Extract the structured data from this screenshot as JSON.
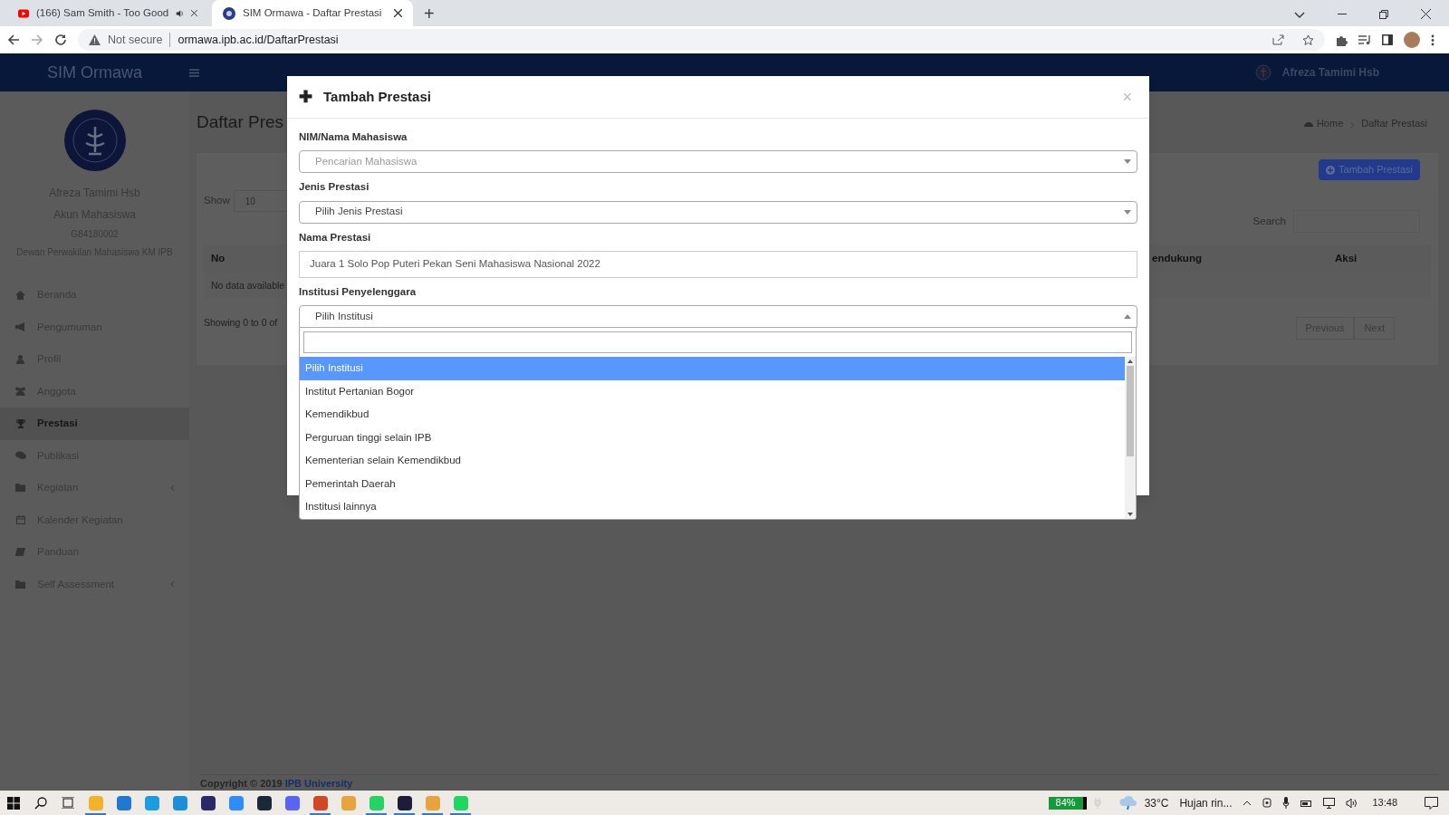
{
  "browser": {
    "tabs": [
      {
        "title": "(166) Sam Smith - Too Good",
        "selected": false,
        "audio": true
      },
      {
        "title": "SIM Ormawa - Daftar Prestasi",
        "selected": true,
        "audio": false
      }
    ],
    "new_tab": "+",
    "security": "Not secure",
    "url": "ormawa.ipb.ac.id/DaftarPrestasi"
  },
  "navbar": {
    "brand": "SIM Ormawa",
    "user": "Afreza Tamimi Hsb"
  },
  "sidebar": {
    "name": "Afreza Tamimi Hsb",
    "role": "Akun Mahasiswa",
    "nim": "G84180002",
    "organization": "Dewan Perwakilan Mahasiswa KM IPB",
    "items": [
      {
        "label": "Beranda",
        "selected": false,
        "expandable": false
      },
      {
        "label": "Pengumuman",
        "selected": false,
        "expandable": false
      },
      {
        "label": "Profil",
        "selected": false,
        "expandable": false
      },
      {
        "label": "Anggota",
        "selected": false,
        "expandable": false
      },
      {
        "label": "Prestasi",
        "selected": true,
        "expandable": false
      },
      {
        "label": "Publikasi",
        "selected": false,
        "expandable": false
      },
      {
        "label": "Kegiatan",
        "selected": false,
        "expandable": true
      },
      {
        "label": "Kalender Kegiatan",
        "selected": false,
        "expandable": false
      },
      {
        "label": "Panduan",
        "selected": false,
        "expandable": false
      },
      {
        "label": "Self Assessment",
        "selected": false,
        "expandable": true
      }
    ]
  },
  "content": {
    "title": "Daftar Pres",
    "breadcrumb": [
      "Home",
      "Daftar Prestasi"
    ],
    "add_button": "Tambah Prestasi",
    "show_label": "Show",
    "page_size": "10",
    "search_label": "Search",
    "table": {
      "columns": [
        "No",
        "endukung",
        "Aksi"
      ],
      "empty_text": "No data available"
    },
    "info": "Showing 0 to 0 of",
    "pagination": [
      "Previous",
      "Next"
    ]
  },
  "footer": {
    "text": "Copyright © 2019",
    "link": "IPB University"
  },
  "modal": {
    "icon": "✚",
    "title": "Tambah Prestasi",
    "close": "×",
    "fields": [
      {
        "label": "NIM/Nama Mahasiswa",
        "kind": "select",
        "placeholder": "Pencarian Mahasiswa",
        "open": false
      },
      {
        "label": "Jenis Prestasi",
        "kind": "select",
        "value": "Pilih Jenis Prestasi",
        "open": false
      },
      {
        "label": "Nama Prestasi",
        "kind": "text",
        "value": "Juara 1 Solo Pop Puteri Pekan Seni Mahasiswa Nasional 2022"
      },
      {
        "label": "Institusi Penyelenggara",
        "kind": "select",
        "value": "Pilih Institusi",
        "open": true,
        "options": [
          {
            "label": "Pilih Institusi",
            "selected": true
          },
          {
            "label": "Institut Pertanian Bogor",
            "selected": false
          },
          {
            "label": "Kemendikbud",
            "selected": false
          },
          {
            "label": "Perguruan tinggi selain IPB",
            "selected": false
          },
          {
            "label": "Kementerian selain Kemendikbud",
            "selected": false
          },
          {
            "label": "Pemerintah Daerah",
            "selected": false
          },
          {
            "label": "Institusi lainnya",
            "selected": false
          }
        ]
      }
    ]
  },
  "taskbar": {
    "apps": [
      {
        "running": true
      },
      {
        "running": false
      },
      {
        "running": false
      },
      {
        "running": false
      },
      {
        "running": false
      },
      {
        "running": false
      },
      {
        "running": false
      },
      {
        "running": false
      },
      {
        "running": true
      },
      {
        "running": false
      },
      {
        "running": true
      },
      {
        "running": true
      },
      {
        "running": true
      },
      {
        "running": true
      }
    ],
    "battery": "84%",
    "temperature": "33°C",
    "weather": "Hujan rin...",
    "time": "13:48"
  }
}
